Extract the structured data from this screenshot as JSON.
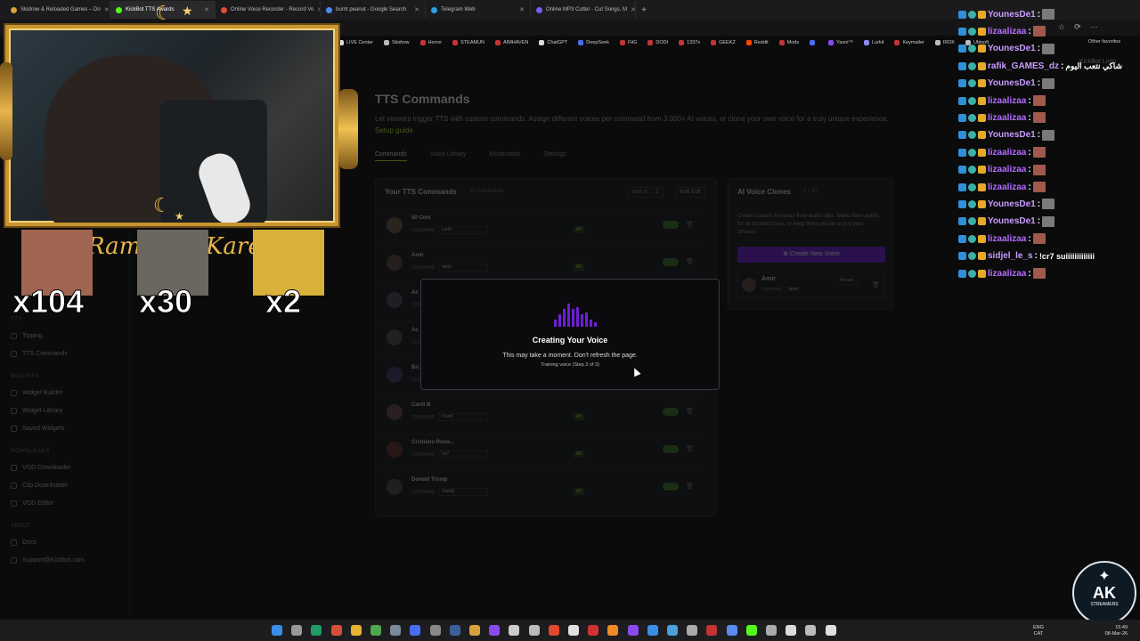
{
  "browser": {
    "tabs": [
      {
        "title": "Skidrow & Reloaded Games – Do",
        "color": "#d6a23c",
        "active": false
      },
      {
        "title": "KickBot TTS Awards",
        "color": "#53fc18",
        "active": true
      },
      {
        "title": "Online Voice Recorder - Record Vo",
        "color": "#e24c3a",
        "active": false
      },
      {
        "title": "burnt peanut - Google Search",
        "color": "#4a8af4",
        "active": false
      },
      {
        "title": "Telegram Web",
        "color": "#2aa3e0",
        "active": false
      },
      {
        "title": "Online MP3 Cutter - Cut Songs, M",
        "color": "#7b5cf0",
        "active": false
      }
    ],
    "address_fragment": "/dashboard",
    "bookmarks": [
      {
        "label": "LIVE Center",
        "color": "#e0e0e0"
      },
      {
        "label": "Skidrow",
        "color": "#bbbbbb"
      },
      {
        "label": "Horror",
        "color": "#c43434"
      },
      {
        "label": "STEAMUN",
        "color": "#c43434"
      },
      {
        "label": "AIMHAVEN",
        "color": "#c43434"
      },
      {
        "label": "ChatGPT",
        "color": "#dddddd"
      },
      {
        "label": "DeepSeek",
        "color": "#4a6cf0"
      },
      {
        "label": "FitG",
        "color": "#c43434"
      },
      {
        "label": "DODI",
        "color": "#c43434"
      },
      {
        "label": "1337x",
        "color": "#c43434"
      },
      {
        "label": "GEEKZ",
        "color": "#c43434"
      },
      {
        "label": "Reddit",
        "color": "#ff4500"
      },
      {
        "label": "Mods",
        "color": "#c43434"
      },
      {
        "label": "",
        "color": "#4a6cf0"
      },
      {
        "label": "Yasni™",
        "color": "#8a4af0"
      },
      {
        "label": "Lurkit",
        "color": "#8a8af0"
      },
      {
        "label": "Keymailer",
        "color": "#c43434"
      },
      {
        "label": "IRDK",
        "color": "#bbbbbb"
      },
      {
        "label": "Ubisoft",
        "color": "#bbbbbb"
      }
    ],
    "other_favorites": "Other favorites",
    "kickbot_logo_alt": "KickBot Logo"
  },
  "overlay": {
    "counters": [
      "x104",
      "x30",
      "x2"
    ],
    "ramadan_text": "Ramadan Kareem"
  },
  "sidebar": {
    "items": [
      {
        "section": "TTS",
        "label": "Tipping"
      },
      {
        "section": "",
        "label": "TTS Commands"
      },
      {
        "section": "WIDGETS",
        "label": "Widget Builder"
      },
      {
        "section": "",
        "label": "Widget Library"
      },
      {
        "section": "",
        "label": "Saved Widgets"
      },
      {
        "section": "DOWNLOADS",
        "label": "VOD Downloader"
      },
      {
        "section": "",
        "label": "Clip Downloader"
      },
      {
        "section": "",
        "label": "VOD Editor"
      },
      {
        "section": "ABOUT",
        "label": "Docs"
      },
      {
        "section": "",
        "label": "Support@Kickbot.com"
      }
    ]
  },
  "main": {
    "title": "TTS Commands",
    "description": "Let viewers trigger TTS with custom commands. Assign different voices per command from 3,000+ AI voices, or clone your own voice for a truly unique experience.",
    "setup_link": "Setup guide",
    "tabs": [
      "Commands",
      "Voice Library",
      "Moderation",
      "Settings"
    ],
    "commands_panel": {
      "title": "Your TTS Commands",
      "count": "21 commands",
      "sort": "Sort: A → Z",
      "bulk_edit": "Bulk Edit",
      "command_label": "COMMAND",
      "all_badge": "All",
      "rows": [
        {
          "name": "50 Cent",
          "command": "!cent"
        },
        {
          "name": "Amir",
          "command": "!amir"
        },
        {
          "name": "Ac",
          "command": ""
        },
        {
          "name": "Ac",
          "command": ""
        },
        {
          "name": "Bri",
          "command": ""
        },
        {
          "name": "Cardi B",
          "command": "!cardi"
        },
        {
          "name": "Cristiano Rona...",
          "command": "!cr7"
        },
        {
          "name": "Donald Trump",
          "command": "!trump"
        }
      ]
    },
    "clones_panel": {
      "title": "AI Voice Clones",
      "count": "1 / 10",
      "description": "Create custom AI voices from audio clips. Make them public for all Kickbot users, or keep them private to just your streams.",
      "create_button": "Create New Voice",
      "clone": {
        "name": "Amir",
        "command_label": "Command",
        "command": "!amir",
        "status": "Private"
      }
    }
  },
  "modal": {
    "title": "Creating Your Voice",
    "message": "This may take a moment. Don't refresh the page.",
    "status": "Training voice (Step 2 of 3)",
    "accent": "#6d1fd6"
  },
  "chat": [
    {
      "user": "YounesDe1",
      "color": "#c89cff",
      "text": ""
    },
    {
      "user": "lizaalizaa",
      "color": "#b46bff",
      "text": ""
    },
    {
      "user": "YounesDe1",
      "color": "#c89cff",
      "text": ""
    },
    {
      "user": "rafik_GAMES_dz",
      "color": "#c89cff",
      "text": "شاكي نتعب اليوم"
    },
    {
      "user": "YounesDe1",
      "color": "#c89cff",
      "text": ""
    },
    {
      "user": "lizaalizaa",
      "color": "#b46bff",
      "text": ""
    },
    {
      "user": "lizaalizaa",
      "color": "#b46bff",
      "text": ""
    },
    {
      "user": "YounesDe1",
      "color": "#c89cff",
      "text": ""
    },
    {
      "user": "lizaalizaa",
      "color": "#b46bff",
      "text": ""
    },
    {
      "user": "lizaalizaa",
      "color": "#b46bff",
      "text": ""
    },
    {
      "user": "lizaalizaa",
      "color": "#b46bff",
      "text": ""
    },
    {
      "user": "YounesDe1",
      "color": "#c89cff",
      "text": ""
    },
    {
      "user": "YounesDe1",
      "color": "#c89cff",
      "text": ""
    },
    {
      "user": "lizaalizaa",
      "color": "#b46bff",
      "text": ""
    },
    {
      "user": "sidjel_le_s",
      "color": "#c89cff",
      "text": "!cr7 suiiiiiiiiiiiii"
    },
    {
      "user": "lizaalizaa",
      "color": "#b46bff",
      "text": ""
    }
  ],
  "taskbar": {
    "lang": "ENG",
    "region": "CAT",
    "time": "15:49",
    "date": "08-Mar-26"
  },
  "watermark": {
    "brand": "AK",
    "sub": "STREAMERS"
  }
}
